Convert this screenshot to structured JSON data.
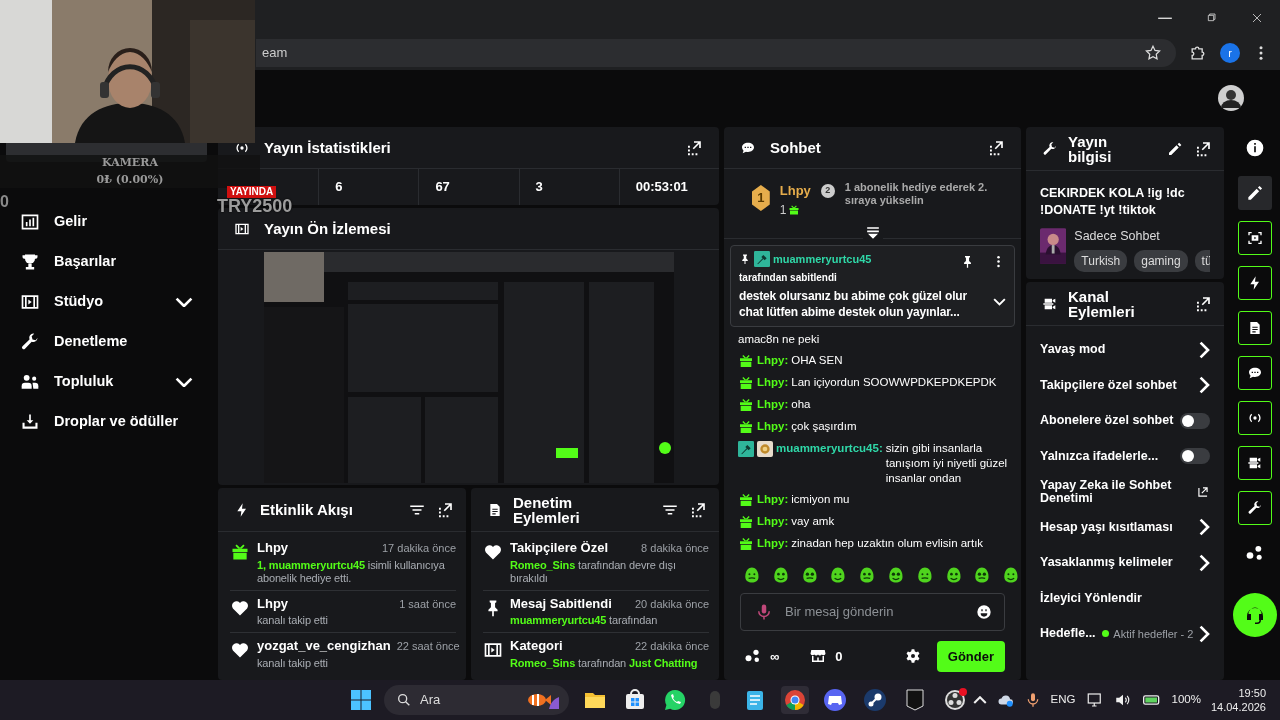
{
  "browser": {
    "address_fragment": "eam",
    "profile_initial": "r"
  },
  "webcam_overlay": {
    "label": "KAMERA",
    "amount": "0₺ (0.00%)",
    "fragment": "0",
    "live_badge": "YAYINDA",
    "goal_text": "TRY2500"
  },
  "sidebar": {
    "items": [
      {
        "kind": "revenue",
        "label": "Gelir"
      },
      {
        "kind": "achievements",
        "label": "Başarılar"
      },
      {
        "kind": "studio",
        "label": "Stüdyo",
        "expanded": false
      },
      {
        "kind": "moderation",
        "label": "Denetleme"
      },
      {
        "kind": "community",
        "label": "Topluluk",
        "expanded": false
      },
      {
        "kind": "drops",
        "label": "Droplar ve ödüller"
      }
    ]
  },
  "stream_stats": {
    "title": "Yayın İstatistikleri",
    "values": [
      "6",
      "67",
      "3",
      "00:53:01"
    ]
  },
  "stream_preview": {
    "title": "Yayın Ön İzlemesi"
  },
  "activity_feed": {
    "title": "Etkinlik Akışı",
    "items": [
      {
        "kind": "gift",
        "user": "Lhpy",
        "time": "17 dakika önce",
        "parts": [
          {
            "text": "1, muammeryurtcu45",
            "highlight": true
          },
          {
            "text": " isimli kullanıcıya abonelik hediye etti.",
            "highlight": false
          }
        ]
      },
      {
        "kind": "heart",
        "user": "Lhpy",
        "time": "1 saat önce",
        "parts": [
          {
            "text": "kanalı takip etti",
            "highlight": false
          }
        ]
      },
      {
        "kind": "heart",
        "user": "yozgat_ve_cengizhan",
        "time": "22 saat önce",
        "parts": [
          {
            "text": "kanalı takip etti",
            "highlight": false
          }
        ]
      }
    ]
  },
  "mod_actions": {
    "title": "Denetim Eylemleri",
    "items": [
      {
        "kind": "heart",
        "title": "Takipçilere Özel",
        "time": "8 dakika önce",
        "parts": [
          {
            "text": "Romeo_Sins",
            "highlight": true
          },
          {
            "text": " tarafından devre dışı bırakıldı",
            "highlight": false
          }
        ]
      },
      {
        "kind": "pin",
        "title": "Mesaj Sabitlendi",
        "time": "20 dakika önce",
        "parts": [
          {
            "text": "muammeryurtcu45",
            "highlight": true
          },
          {
            "text": " tarafından",
            "highlight": false
          }
        ]
      },
      {
        "kind": "category",
        "title": "Kategori",
        "time": "22 dakika önce",
        "parts": [
          {
            "text": "Romeo_Sins",
            "highlight": true
          },
          {
            "text": " tarafından ",
            "highlight": false
          },
          {
            "text": "Just Chatting",
            "highlight": true
          }
        ]
      }
    ]
  },
  "chat": {
    "title": "Sohbet",
    "leaderboard": {
      "rank": "1",
      "user": "Lhpy",
      "count": "1",
      "next_rank": "2",
      "hint": "1 abonelik hediye ederek 2. sıraya yükselin"
    },
    "pinned": {
      "user": "muammeryurtcu45",
      "by_text": "tarafından sabitlendi",
      "text": "destek olursanız bu abime çok güzel olur chat lütfen abime destek olun yayınlar...",
      "expanded": false
    },
    "messages": [
      {
        "kind": "continuation",
        "text": "amac8n ne peki"
      },
      {
        "kind": "gifter",
        "user": "Lhpy:",
        "color": "#53fc18",
        "text": "OHA SEN"
      },
      {
        "kind": "gifter",
        "user": "Lhpy:",
        "color": "#53fc18",
        "text": "Lan içiyordun SOOWWPDKEPDKEPDK"
      },
      {
        "kind": "gifter",
        "user": "Lhpy:",
        "color": "#53fc18",
        "text": "oha"
      },
      {
        "kind": "gifter",
        "user": "Lhpy:",
        "color": "#53fc18",
        "text": "çok şaşırdım"
      },
      {
        "kind": "moderator",
        "user": "muammeryurtcu45:",
        "color": "#2fd8a8",
        "text": "sizin gibi insanlarla tanışıom iyi niyetli güzel insanlar ondan"
      },
      {
        "kind": "gifter",
        "user": "Lhpy:",
        "color": "#53fc18",
        "text": "icmiyon mu"
      },
      {
        "kind": "gifter",
        "user": "Lhpy:",
        "color": "#53fc18",
        "text": "vay amk"
      },
      {
        "kind": "gifter",
        "user": "Lhpy:",
        "color": "#53fc18",
        "text": "zinadan hep uzaktın olum evlisin artık"
      }
    ],
    "input": {
      "placeholder": "Bir mesaj gönderin"
    },
    "points": "∞",
    "store_count": "0",
    "send_label": "Gönder"
  },
  "stream_info": {
    "title": "Yayın bilgisi",
    "stream_title": "CEKIRDEK KOLA !ig !dc !DONATE !yt !tiktok",
    "category": "Sadece Sohbet",
    "tags": [
      "Turkish",
      "gaming",
      "tü"
    ]
  },
  "channel_actions": {
    "title": "Kanal Eylemleri",
    "items": [
      {
        "kind": "arrow",
        "label": "Yavaş mod"
      },
      {
        "kind": "arrow",
        "label": "Takipçilere özel sohbet"
      },
      {
        "kind": "toggle",
        "label": "Abonelere özel sohbet",
        "on": false
      },
      {
        "kind": "toggle",
        "label": "Yalnızca ifadelerle...",
        "on": false
      },
      {
        "kind": "external",
        "label": "Yapay Zeka ile Sohbet Denetimi"
      },
      {
        "kind": "arrow",
        "label": "Hesap yaşı kısıtlaması"
      },
      {
        "kind": "arrow",
        "label": "Yasaklanmış kelimeler"
      },
      {
        "kind": "plain",
        "label": "İzleyici Yönlendir"
      },
      {
        "kind": "status",
        "label": "Hedefle...",
        "status": "Aktif hedefler - 2",
        "color": "#53fc18"
      }
    ]
  },
  "rail": {
    "items": [
      {
        "kind": "info",
        "on": false,
        "selected": false
      },
      {
        "kind": "edit",
        "on": false,
        "selected": true
      },
      {
        "kind": "capture",
        "on": true,
        "selected": false
      },
      {
        "kind": "bolt",
        "on": true,
        "selected": false
      },
      {
        "kind": "doc",
        "on": true,
        "selected": false
      },
      {
        "kind": "chat",
        "on": true,
        "selected": false
      },
      {
        "kind": "broadcast",
        "on": true,
        "selected": false
      },
      {
        "kind": "camera",
        "on": true,
        "selected": false
      },
      {
        "kind": "wrench",
        "on": true,
        "selected": false
      },
      {
        "kind": "dots",
        "on": false,
        "selected": false
      }
    ]
  },
  "taskbar": {
    "search_label": "Ara",
    "language": "ENG",
    "battery": "100%",
    "time": "19:50",
    "date": "14.04.2026"
  }
}
